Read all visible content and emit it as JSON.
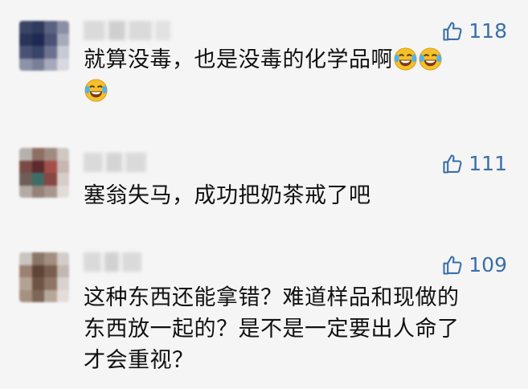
{
  "comments": [
    {
      "likes": "118",
      "text": "就算没毒，也是没毒的化学品啊",
      "emojis": [
        "😂",
        "😂",
        "😂"
      ],
      "emoji_icon": "tears-of-joy-icon"
    },
    {
      "likes": "111",
      "text": "塞翁失马，成功把奶茶戒了吧"
    },
    {
      "likes": "109",
      "lines": [
        "这种东西还能拿错？难道样品和现做的",
        "东西放一起的？是不是一定要出人命了",
        "才会重视？"
      ]
    }
  ],
  "colors": {
    "background": "#f5f5f5",
    "like_accent": "#3a6fa8",
    "text": "#111111"
  },
  "icons": {
    "like": "thumbs-up-icon",
    "emoji": "tears-of-joy-icon"
  }
}
